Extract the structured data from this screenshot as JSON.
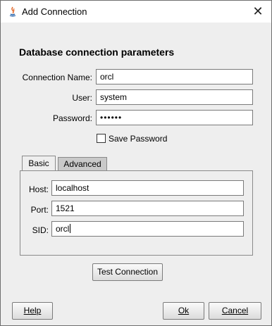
{
  "window": {
    "title": "Add Connection",
    "close_glyph": "✕"
  },
  "heading": "Database connection parameters",
  "fields": {
    "connection_name": {
      "label": "Connection Name:",
      "value": "orcl"
    },
    "user": {
      "label": "User:",
      "value": "system"
    },
    "password": {
      "label": "Password:",
      "value": "••••••"
    }
  },
  "save_password": {
    "label": "Save Password",
    "checked": false
  },
  "tabs": [
    {
      "label": "Basic"
    },
    {
      "label": "Advanced"
    }
  ],
  "basic": {
    "host": {
      "label": "Host:",
      "value": "localhost"
    },
    "port": {
      "label": "Port:",
      "value": "1521"
    },
    "sid": {
      "label": "SID:",
      "value": "orcl"
    }
  },
  "buttons": {
    "test_connection": "Test Connection",
    "help": "Help",
    "ok": "Ok",
    "cancel": "Cancel"
  },
  "colors": {
    "window_bg": "#eeeeee",
    "tab_inactive": "#c9c9c9",
    "border": "#7a7a7a"
  }
}
